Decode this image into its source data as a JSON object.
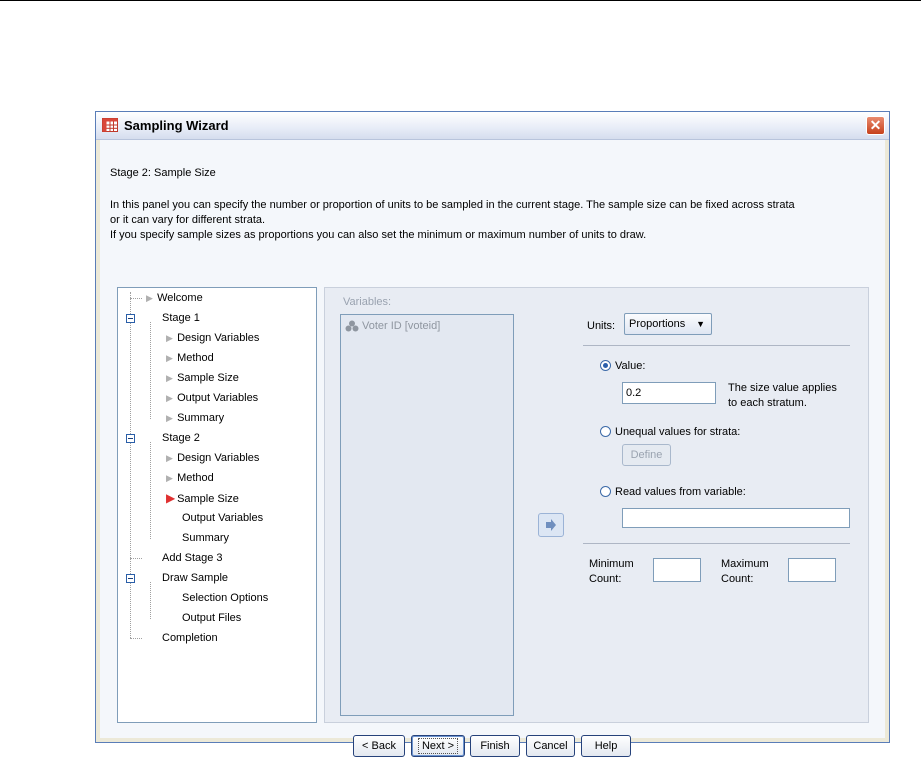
{
  "window": {
    "title": "Sampling Wizard",
    "close_glyph": "✕"
  },
  "stage_title": "Stage 2: Sample Size",
  "description": [
    "In this panel you can specify the number or proportion of units to be sampled in the current stage. The sample size can be fixed across strata",
    "or it can vary for different strata.",
    "If you specify sample sizes as proportions you can also set the minimum or maximum number of units to draw."
  ],
  "tree": {
    "items": [
      {
        "label": "Welcome"
      },
      {
        "label": "Stage 1"
      },
      {
        "label": "Design Variables"
      },
      {
        "label": "Method"
      },
      {
        "label": "Sample Size"
      },
      {
        "label": "Output Variables"
      },
      {
        "label": "Summary"
      },
      {
        "label": "Stage 2"
      },
      {
        "label": "Design Variables"
      },
      {
        "label": "Method"
      },
      {
        "label": "Sample Size"
      },
      {
        "label": "Output Variables"
      },
      {
        "label": "Summary"
      },
      {
        "label": "Add Stage 3"
      },
      {
        "label": "Draw Sample"
      },
      {
        "label": "Selection Options"
      },
      {
        "label": "Output Files"
      },
      {
        "label": "Completion"
      }
    ],
    "selected": "Sample Size"
  },
  "variables": {
    "label": "Variables:",
    "items": [
      "Voter ID [voteid]"
    ]
  },
  "units": {
    "label": "Units:",
    "selected": "Proportions"
  },
  "size": {
    "value_label": "Value:",
    "value": "0.2",
    "value_note_1": "The size value applies",
    "value_note_2": "to each stratum.",
    "unequal_label": "Unequal values for strata:",
    "define_label": "Define",
    "read_label": "Read values from variable:",
    "read_value": "",
    "selected_option": "Value"
  },
  "counts": {
    "min_line1": "Minimum",
    "min_line2": "Count:",
    "max_line1": "Maximum",
    "max_line2": "Count:",
    "min_value": "",
    "max_value": ""
  },
  "buttons": {
    "back": "< Back",
    "next": "Next >",
    "finish": "Finish",
    "cancel": "Cancel",
    "help": "Help"
  },
  "colors": {
    "title_bar": "#dce4f2",
    "close_button": "#d05a37",
    "active_arrow": "#e03030",
    "panel": "#e8ecf3"
  }
}
